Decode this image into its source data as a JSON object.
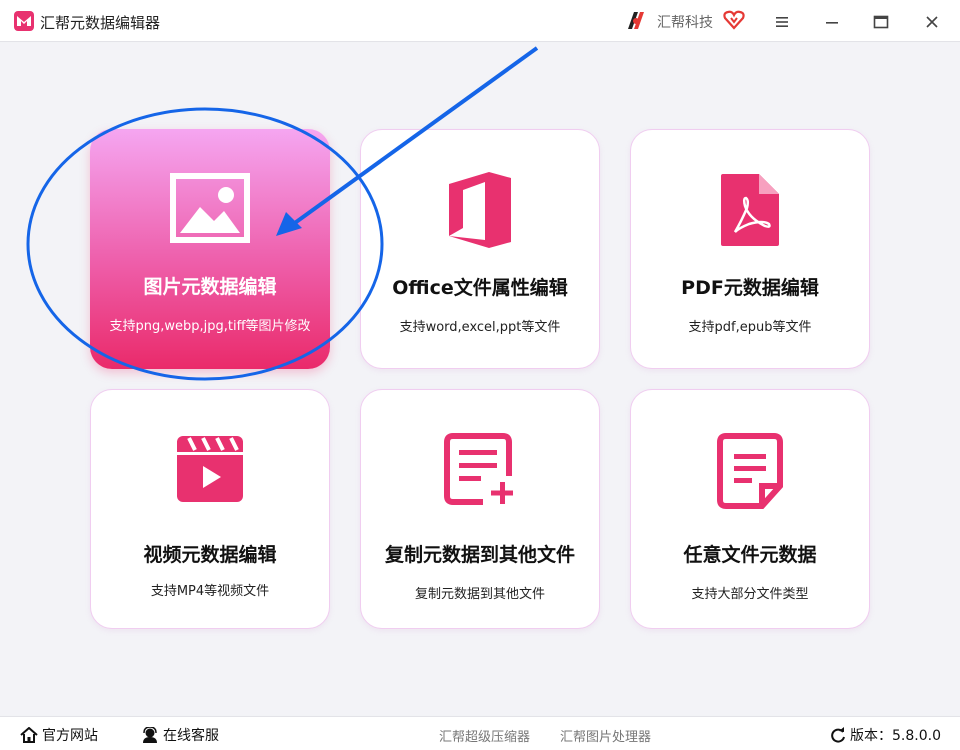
{
  "app": {
    "title": "汇帮元数据编辑器",
    "brand": "汇帮科技"
  },
  "colors": {
    "accent": "#ea2a6a",
    "active_top": "#f5a6f1",
    "annotation": "#1565e8"
  },
  "cards": [
    {
      "title": "图片元数据编辑",
      "desc": "支持png,webp,jpg,tiff等图片修改",
      "icon": "image-icon",
      "active": true
    },
    {
      "title": "Office文件属性编辑",
      "desc": "支持word,excel,ppt等文件",
      "icon": "office-icon",
      "active": false
    },
    {
      "title": "PDF元数据编辑",
      "desc": "支持pdf,epub等文件",
      "icon": "pdf-icon",
      "active": false
    },
    {
      "title": "视频元数据编辑",
      "desc": "支持MP4等视频文件",
      "icon": "video-icon",
      "active": false
    },
    {
      "title": "复制元数据到其他文件",
      "desc": "复制元数据到其他文件",
      "icon": "copy-doc-icon",
      "active": false
    },
    {
      "title": "任意文件元数据",
      "desc": "支持大部分文件类型",
      "icon": "document-icon",
      "active": false
    }
  ],
  "statusbar": {
    "website": "官方网站",
    "support": "在线客服",
    "link1": "汇帮超级压缩器",
    "link2": "汇帮图片处理器",
    "version": "版本：5.8.0.0"
  }
}
